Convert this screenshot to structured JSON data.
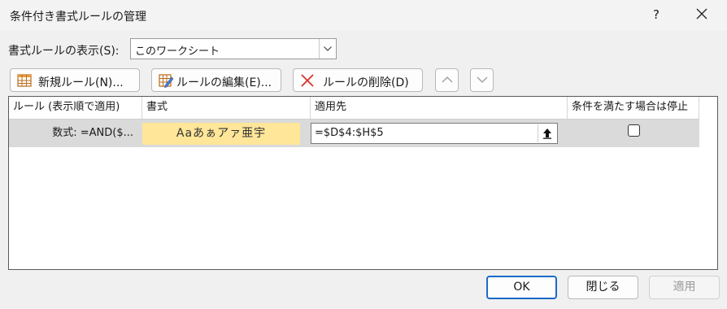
{
  "window": {
    "title": "条件付き書式ルールの管理",
    "help": "?"
  },
  "show_rules": {
    "label": "書式ルールの表示(S):",
    "selected": "このワークシート"
  },
  "toolbar": {
    "new_rule": "新規ルール(N)...",
    "edit_rule": "ルールの編集(E)...",
    "delete_rule": "ルールの削除(D)"
  },
  "table": {
    "headers": [
      "ルール (表示順で適用)",
      "書式",
      "適用先",
      "条件を満たす場合は停止"
    ],
    "rows": [
      {
        "rule": "数式: =AND($...",
        "format_preview": "Aaあぁアァ亜宇",
        "applies_to": "=$D$4:$H$5",
        "stop_if_true": false,
        "preview_color": "#ffe699"
      }
    ]
  },
  "footer": {
    "ok": "OK",
    "close": "閉じる",
    "apply": "適用"
  },
  "colors": {
    "accent": "#1b6ac9",
    "delete_icon": "#d9302c",
    "selected_row": "#dadada"
  }
}
